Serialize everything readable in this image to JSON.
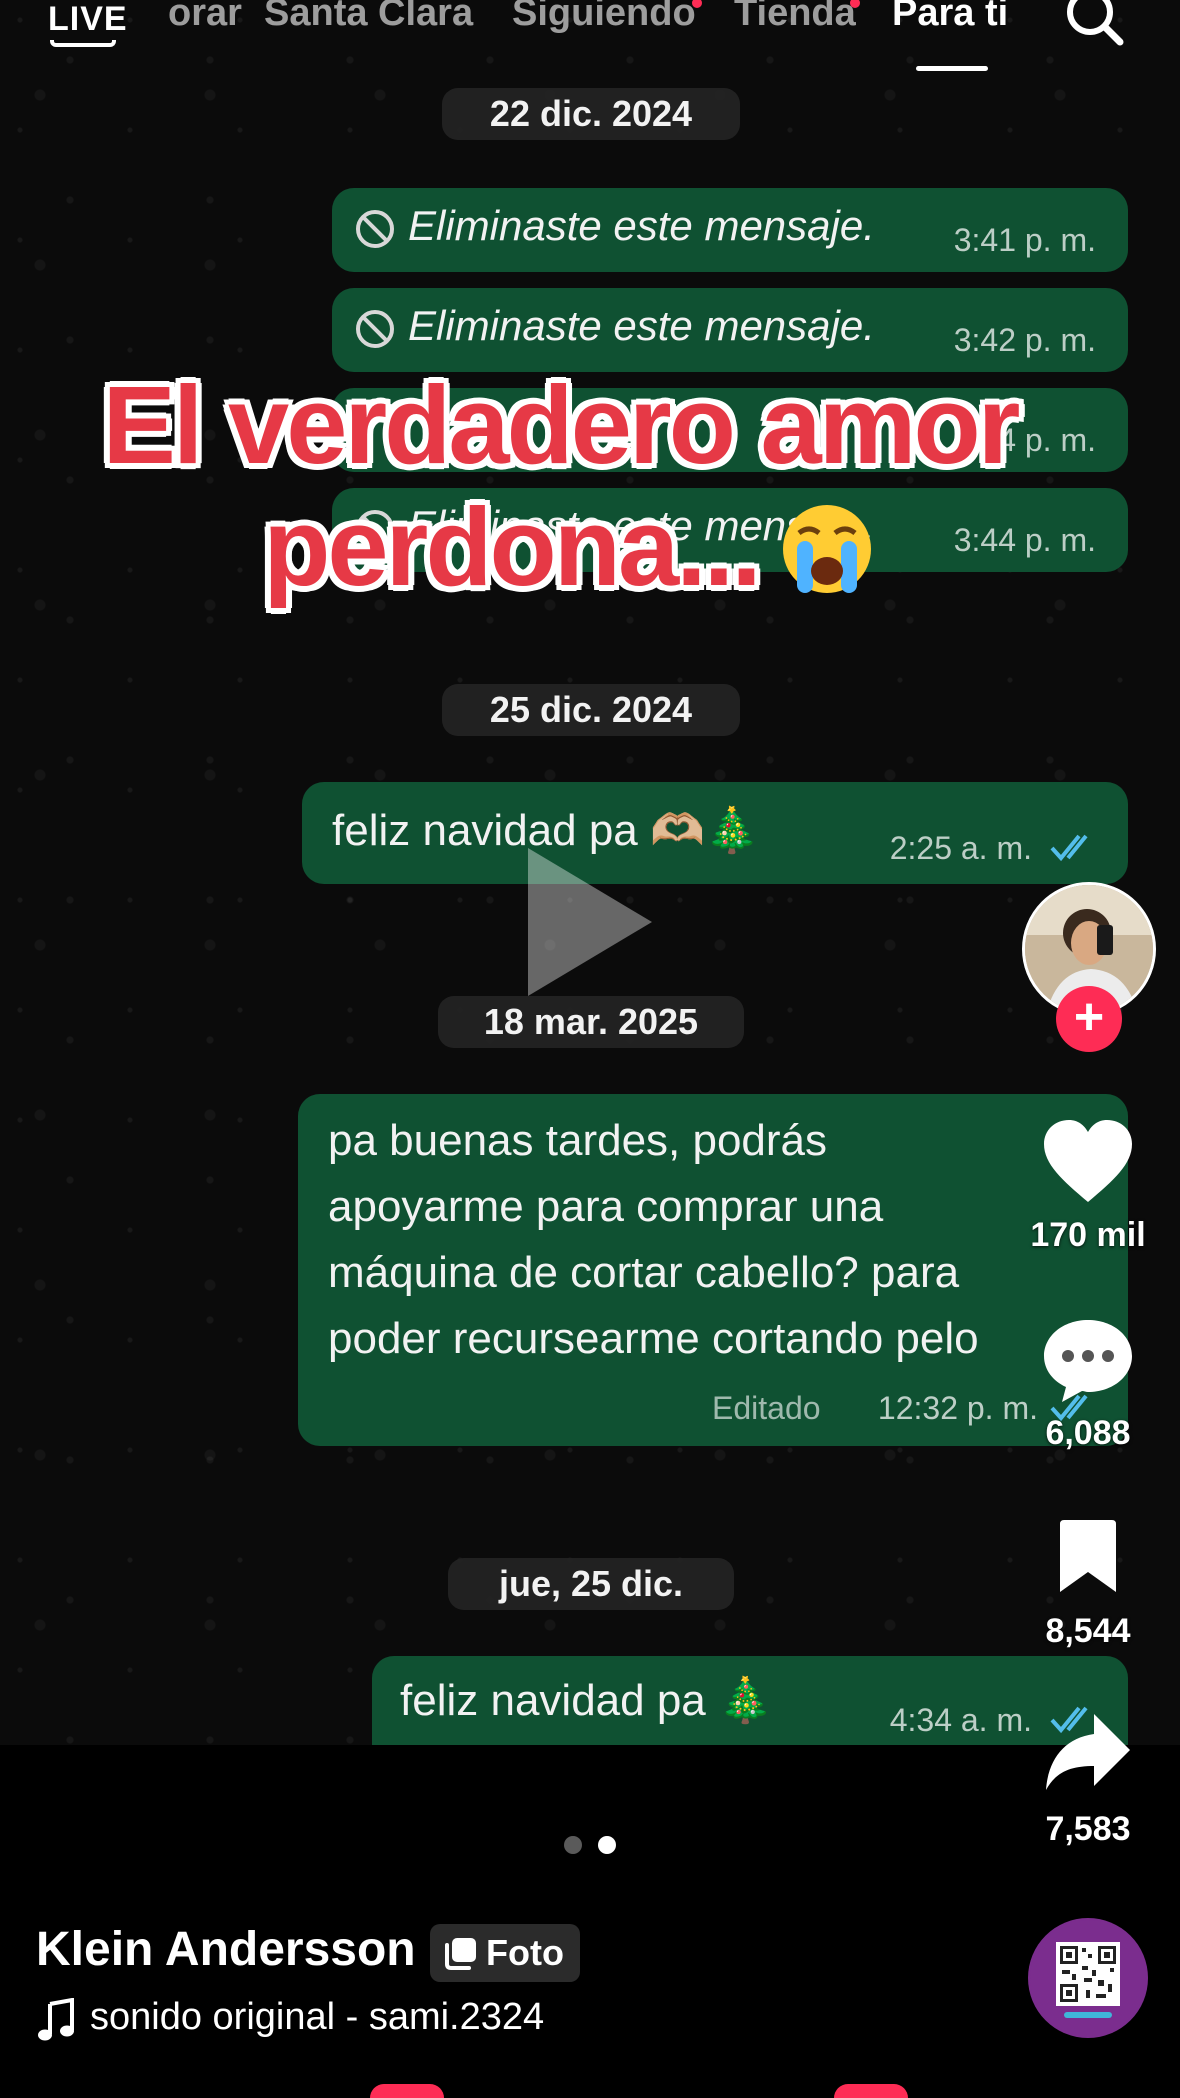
{
  "top_nav": {
    "live_label": "LIVE",
    "tabs": [
      "orar",
      "Santa Clara",
      "Siguiendo",
      "Tienda",
      "Para ti"
    ],
    "active_tab": "Para ti"
  },
  "overlay_title": {
    "line1": "El verdadero amor",
    "line2": "perdona..."
  },
  "chat": {
    "dates": [
      "22 dic. 2024",
      "25 dic. 2024",
      "18 mar. 2025",
      "jue, 25 dic."
    ],
    "deleted_messages": [
      {
        "text": "Eliminaste este mensaje.",
        "time": "3:41 p. m."
      },
      {
        "text": "Eliminaste este mensaje.",
        "time": "3:42 p. m."
      },
      {
        "text": "",
        "time": "4 p. m."
      },
      {
        "text": "Eliminaste este mensaje.",
        "time": "3:44 p. m."
      }
    ],
    "msg_christmas_1": {
      "text": "feliz navidad pa 🫶🏼🎄",
      "time": "2:25 a. m."
    },
    "msg_request": {
      "lines": [
        "pa buenas tardes, podrás",
        "apoyarme para comprar una",
        "máquina de cortar cabello? para",
        "poder recursearme cortando pelo"
      ],
      "edited_label": "Editado",
      "time": "12:32 p. m."
    },
    "msg_christmas_2": {
      "text": "feliz navidad pa 🎄",
      "time": "4:34 a. m."
    }
  },
  "actions": {
    "likes": "170 mil",
    "comments": "6,088",
    "saves": "8,544",
    "shares": "7,583"
  },
  "post": {
    "author": "Klein Andersson",
    "badge": "Foto",
    "sound": "sonido original - sami.2324"
  },
  "carousel": {
    "total": 2,
    "active": 2
  },
  "colors": {
    "bubble": "#0f5132",
    "accent": "#fe2c55",
    "overlay_text": "#e63946",
    "read_check": "#53bdeb"
  }
}
